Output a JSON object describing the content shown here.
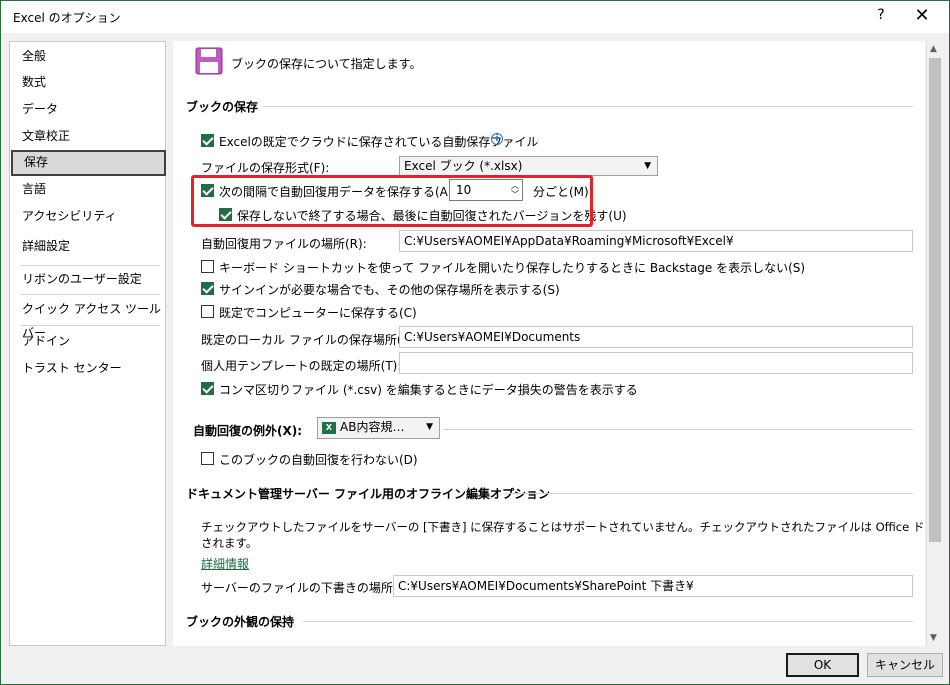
{
  "window": {
    "title": "Excel のオプション",
    "help_glyph": "?",
    "close_glyph": "✕"
  },
  "sidebar": {
    "items": [
      {
        "label": "全般"
      },
      {
        "label": "数式"
      },
      {
        "label": "データ"
      },
      {
        "label": "文章校正"
      },
      {
        "label": "保存",
        "selected": true
      },
      {
        "label": "言語"
      },
      {
        "label": "アクセシビリティ"
      },
      {
        "label": "詳細設定"
      },
      {
        "label": "リボンのユーザー設定"
      },
      {
        "label": "クイック アクセス ツール バー"
      },
      {
        "label": "アドイン"
      },
      {
        "label": "トラスト センター"
      }
    ]
  },
  "header": {
    "description": "ブックの保存について指定します。",
    "icon": "save-floppy-icon"
  },
  "save_section": {
    "title": "ブックの保存",
    "autosave_cloud": {
      "label": "Excelの既定でクラウドに保存されている自動保存ファイル",
      "checked": true
    },
    "format_label": "ファイルの保存形式(F):",
    "format_value": "Excel ブック (*.xlsx)",
    "autorecover": {
      "label": "次の間隔で自動回復用データを保存する(A):",
      "checked": true,
      "minutes": "10",
      "unit": "分ごと(M)"
    },
    "keep_last": {
      "label": "保存しないで終了する場合、最後に自動回復されたバージョンを残す(U)",
      "checked": true
    },
    "autorecover_location_label": "自動回復用ファイルの場所(R):",
    "autorecover_location_value": "C:¥Users¥AOMEI¥AppData¥Roaming¥Microsoft¥Excel¥",
    "backstage": {
      "label": "キーボード ショートカットを使って ファイルを開いたり保存したりするときに Backstage を表示しない(S)",
      "checked": false
    },
    "signin_other": {
      "label": "サインインが必要な場合でも、その他の保存場所を表示する(S)",
      "checked": true
    },
    "save_to_computer": {
      "label": "既定でコンピューターに保存する(C)",
      "checked": false
    },
    "local_location_label": "既定のローカル ファイルの保存場所(I):",
    "local_location_value": "C:¥Users¥AOMEI¥Documents",
    "template_location_label": "個人用テンプレートの既定の場所(T):",
    "template_location_value": "",
    "csv_warning": {
      "label": "コンマ区切りファイル (*.csv) を編集するときにデータ損失の警告を表示する",
      "checked": true
    }
  },
  "exceptions": {
    "label": "自動回復の例外(X):",
    "workbook": "AB内容規…",
    "disable_autorecover": {
      "label": "このブックの自動回復を行わない(D)",
      "checked": false
    }
  },
  "offline": {
    "title": "ドキュメント管理サーバー ファイル用のオフライン編集オプション",
    "notice_line1": "チェックアウトしたファイルをサーバーの [下書き] に保存することはサポートされていません。チェックアウトされたファイルは Office ドキュメント キャッシュに保存",
    "notice_line2": "されます。",
    "more_info": "詳細情報",
    "drafts_label": "サーバーのファイルの下書きの場所(V):",
    "drafts_value": "C:¥Users¥AOMEI¥Documents¥SharePoint 下書き¥"
  },
  "appearance": {
    "title": "ブックの外観の保持"
  },
  "buttons": {
    "ok": "OK",
    "cancel": "キャンセル"
  },
  "colors": {
    "accent": "#1f6f43",
    "highlight_box": "#e8202a"
  }
}
